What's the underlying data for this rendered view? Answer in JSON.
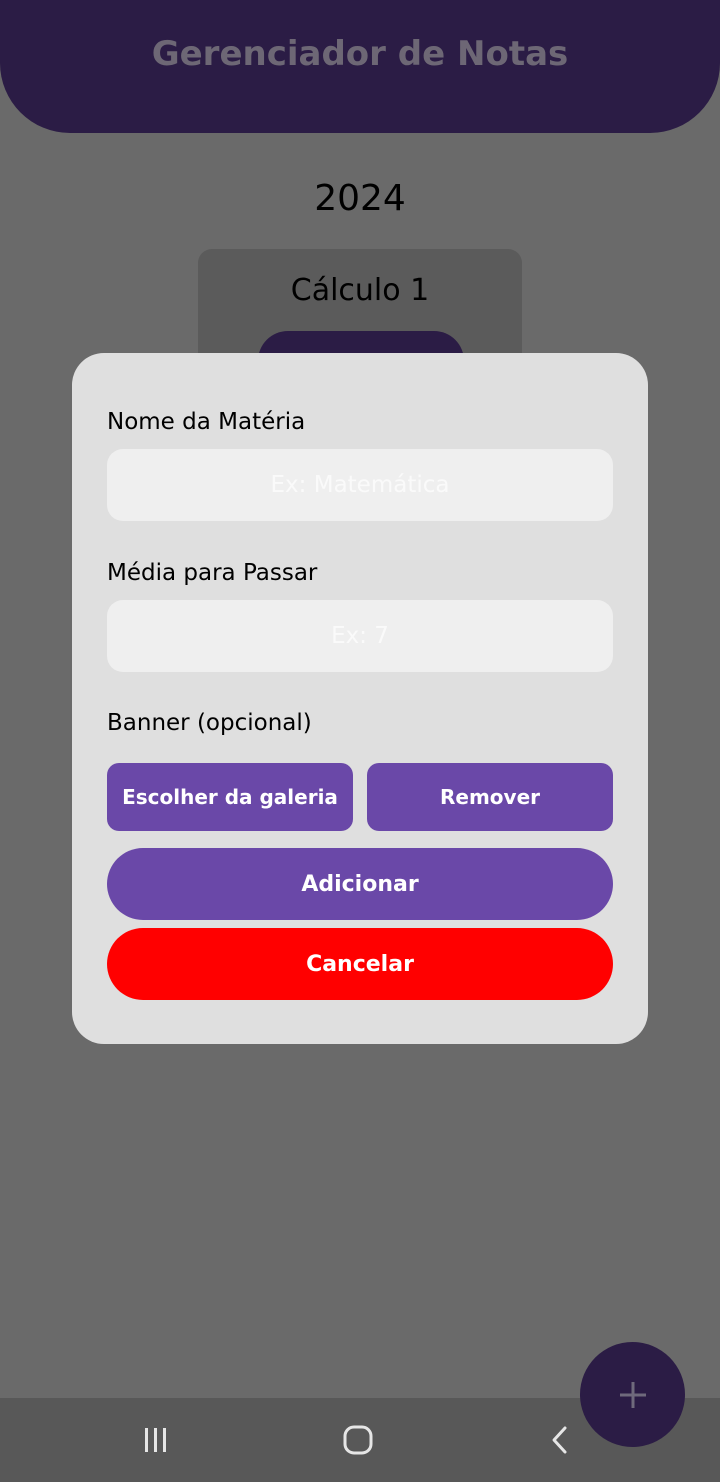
{
  "header": {
    "title": "Gerenciador de Notas"
  },
  "main": {
    "year": "2024",
    "subject_card": {
      "title": "Cálculo 1"
    }
  },
  "modal": {
    "name_label": "Nome da Matéria",
    "name_placeholder": "Ex: Matemática",
    "name_value": "",
    "grade_label": "Média para Passar",
    "grade_placeholder": "Ex: 7",
    "grade_value": "",
    "banner_label": "Banner (opcional)",
    "gallery_button": "Escolher da galeria",
    "remove_button": "Remover",
    "add_button": "Adicionar",
    "cancel_button": "Cancelar"
  },
  "fab": {
    "icon": "plus-icon"
  },
  "navbar": {
    "icons": [
      "recent-apps-icon",
      "home-icon",
      "back-icon"
    ]
  },
  "colors": {
    "header_bg": "#2b1c45",
    "overlay_bg": "#6a6a6a",
    "modal_bg": "#dfdfdf",
    "input_bg": "#efefef",
    "primary_button": "#6a48a8",
    "cancel_button": "#ff0000"
  }
}
